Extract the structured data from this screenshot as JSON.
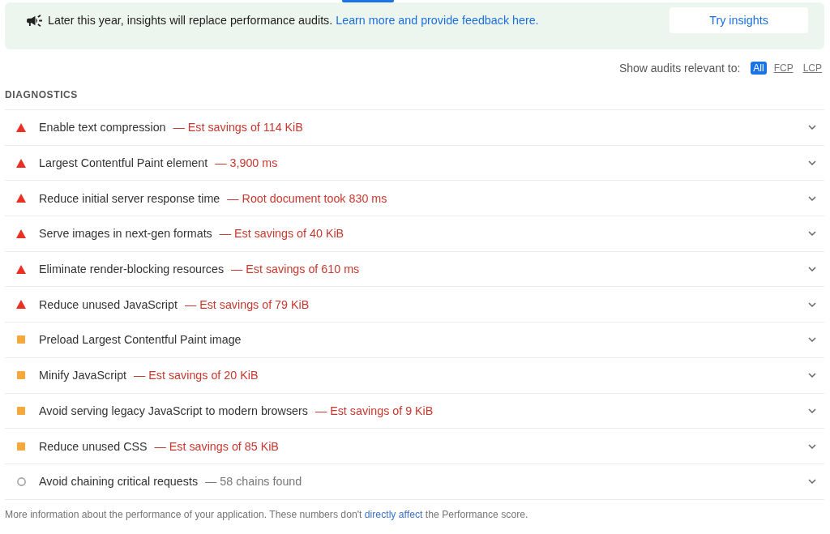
{
  "banner": {
    "message": "Later this year, insights will replace performance audits.",
    "link": "Learn more and provide feedback here.",
    "button": "Try insights"
  },
  "filter": {
    "label": "Show audits relevant to:",
    "options": [
      {
        "label": "All",
        "selected": true
      },
      {
        "label": "FCP",
        "selected": false
      },
      {
        "label": "LCP",
        "selected": false
      }
    ]
  },
  "section": {
    "title": "DIAGNOSTICS",
    "audits": [
      {
        "kind": "fail",
        "title": "Enable text compression",
        "display_value": "— Est savings of 114 KiB",
        "expanded": false
      },
      {
        "kind": "fail",
        "title": "Largest Contentful Paint element",
        "display_value": "— 3,900 ms",
        "expanded": false
      },
      {
        "kind": "fail",
        "title": "Reduce initial server response time",
        "display_value": "— Root document took 830 ms",
        "expanded": false
      },
      {
        "kind": "fail",
        "title": "Serve images in next-gen formats",
        "display_value": "— Est savings of 40 KiB",
        "expanded": false
      },
      {
        "kind": "fail",
        "title": "Eliminate render-blocking resources",
        "display_value": "— Est savings of 610 ms",
        "expanded": false
      },
      {
        "kind": "fail",
        "title": "Reduce unused JavaScript",
        "display_value": "— Est savings of 79 KiB",
        "expanded": false
      },
      {
        "kind": "average",
        "title": "Preload Largest Contentful Paint image",
        "expanded": false
      },
      {
        "kind": "average",
        "title": "Minify JavaScript",
        "display_value": "— Est savings of 20 KiB",
        "expanded": false
      },
      {
        "kind": "average",
        "title": "Avoid serving legacy JavaScript to modern browsers",
        "display_value": "— Est savings of 9 KiB",
        "expanded": false
      },
      {
        "kind": "average",
        "title": "Reduce unused CSS",
        "display_value": "— Est savings of 85 KiB",
        "expanded": false
      },
      {
        "kind": "info",
        "title": "Avoid chaining critical requests",
        "display_value": "— 58 chains found",
        "expanded": false
      }
    ]
  },
  "footer": {
    "before": "More information about the performance of your application. These numbers don't",
    "link": "directly affect",
    "after": "the Performance score."
  }
}
